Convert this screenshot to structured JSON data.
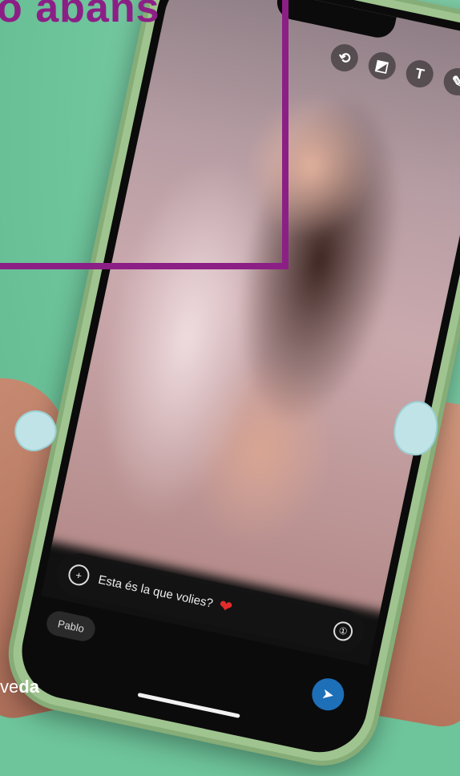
{
  "headline": "o abans",
  "toolbar": {
    "items": [
      {
        "icon": "crop-rotate-icon",
        "glyph": "⟲"
      },
      {
        "icon": "sticker-icon",
        "glyph": "◩"
      },
      {
        "icon": "text-icon",
        "glyph": "T"
      },
      {
        "icon": "pencil-icon",
        "glyph": "✎"
      }
    ]
  },
  "caption": {
    "add_glyph": "+",
    "text": "Esta és la que volies?",
    "emoji": "❤",
    "timer_glyph": "①"
  },
  "recipient": "Pablo",
  "send_glyph": "➤",
  "logo": {
    "prefix": "ve",
    "suffix": "da"
  },
  "colors": {
    "accent": "#8c1f86",
    "background": "#6ec49b",
    "send": "#1d6fb8"
  }
}
